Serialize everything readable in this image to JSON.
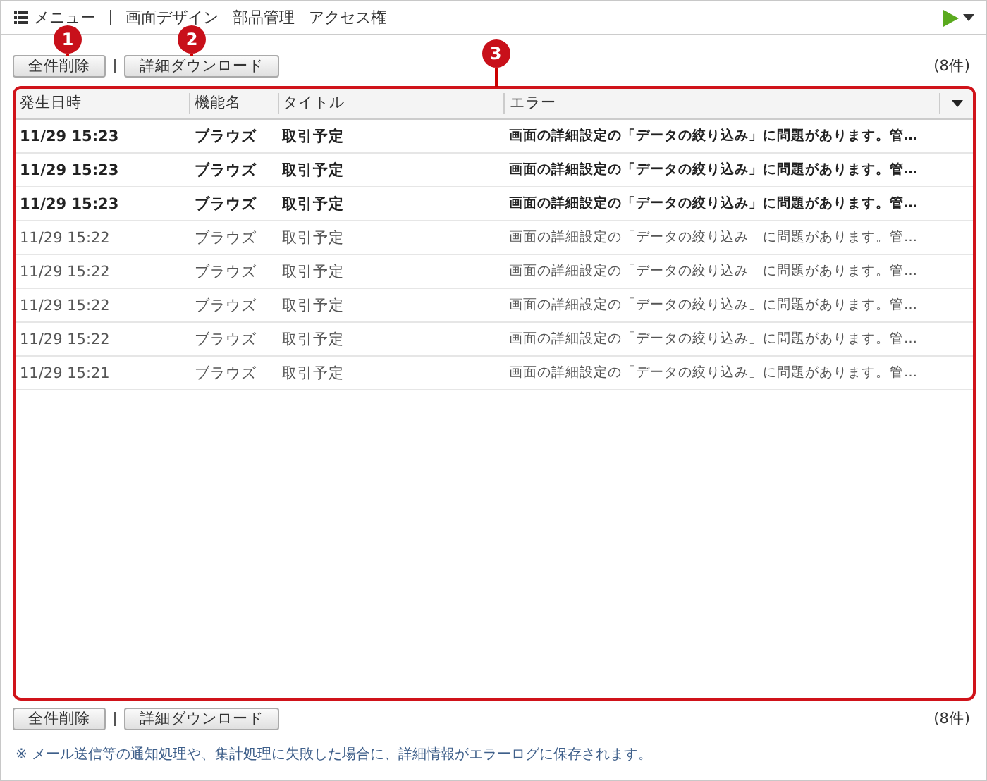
{
  "nav": {
    "items": [
      {
        "label": "メニュー",
        "kind": "menu"
      },
      {
        "label": "画面デザイン",
        "kind": "link"
      },
      {
        "label": "部品管理",
        "kind": "link"
      },
      {
        "label": "アクセス権",
        "kind": "link"
      }
    ]
  },
  "toolbar_top": {
    "buttons": [
      "全件削除",
      "詳細ダウンロード"
    ],
    "count": "(8件)"
  },
  "callouts": [
    "1",
    "2",
    "3"
  ],
  "table": {
    "columns": [
      "発生日時",
      "機能名",
      "タイトル",
      "エラー"
    ],
    "rows": [
      {
        "time": "11/29 15:23",
        "function": "ブラウズ",
        "title": "取引予定",
        "error": "画面の詳細設定の「データの絞り込み」に問題があります。管…",
        "unread": true
      },
      {
        "time": "11/29 15:23",
        "function": "ブラウズ",
        "title": "取引予定",
        "error": "画面の詳細設定の「データの絞り込み」に問題があります。管…",
        "unread": true
      },
      {
        "time": "11/29 15:23",
        "function": "ブラウズ",
        "title": "取引予定",
        "error": "画面の詳細設定の「データの絞り込み」に問題があります。管…",
        "unread": true
      },
      {
        "time": "11/29 15:22",
        "function": "ブラウズ",
        "title": "取引予定",
        "error": "画面の詳細設定の「データの絞り込み」に問題があります。管…",
        "unread": false
      },
      {
        "time": "11/29 15:22",
        "function": "ブラウズ",
        "title": "取引予定",
        "error": "画面の詳細設定の「データの絞り込み」に問題があります。管…",
        "unread": false
      },
      {
        "time": "11/29 15:22",
        "function": "ブラウズ",
        "title": "取引予定",
        "error": "画面の詳細設定の「データの絞り込み」に問題があります。管…",
        "unread": false
      },
      {
        "time": "11/29 15:22",
        "function": "ブラウズ",
        "title": "取引予定",
        "error": "画面の詳細設定の「データの絞り込み」に問題があります。管…",
        "unread": false
      },
      {
        "time": "11/29 15:21",
        "function": "ブラウズ",
        "title": "取引予定",
        "error": "画面の詳細設定の「データの絞り込み」に問題があります。管…",
        "unread": false
      }
    ]
  },
  "toolbar_bottom": {
    "buttons": [
      "全件削除",
      "詳細ダウンロード"
    ],
    "count": "(8件)"
  },
  "note": "※ メール送信等の通知処理や、集計処理に失敗した場合に、詳細情報がエラーログに保存されます。"
}
